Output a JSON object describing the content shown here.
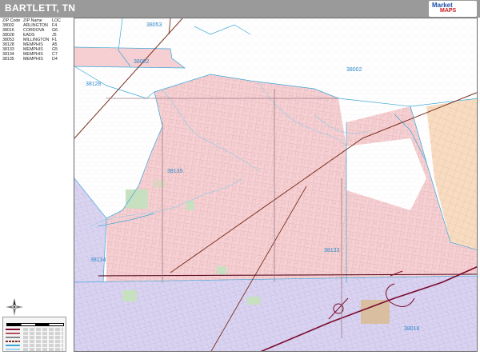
{
  "header": {
    "title": "BARTLETT, TN"
  },
  "legend": {
    "headers": {
      "zip": "ZIP Code",
      "name": "ZIP Name",
      "loc": "LOC"
    },
    "rows": [
      {
        "zip": "38002",
        "name": "ARLINGTON",
        "loc": "F4"
      },
      {
        "zip": "38016",
        "name": "CORDOVA",
        "loc": "G6"
      },
      {
        "zip": "38028",
        "name": "EADS",
        "loc": "J5"
      },
      {
        "zip": "38053",
        "name": "MILLINGTON",
        "loc": "F1"
      },
      {
        "zip": "38128",
        "name": "MEMPHIS",
        "loc": "A5"
      },
      {
        "zip": "38133",
        "name": "MEMPHIS",
        "loc": "G5"
      },
      {
        "zip": "38134",
        "name": "MEMPHIS",
        "loc": "C7"
      },
      {
        "zip": "38135",
        "name": "MEMPHIS",
        "loc": "D4"
      }
    ]
  },
  "map_labels": {
    "z38053": "38053",
    "z38002_west": "38002",
    "z38002_east": "38002",
    "z38128": "38128",
    "z38135": "38135",
    "z38134": "38134",
    "z38133": "38133",
    "z38016": "38016"
  },
  "colors": {
    "zone_38135": "#f6cfd2",
    "zone_38134": "#d9d2f0",
    "zone_38002": "#f8dcc1",
    "zone_38016": "#dfd5f2",
    "zone_38128": "#dad4f1",
    "zip_boundary": "#3aa7d9",
    "rail": "#7a2f1e",
    "highway": "#7a0a2e",
    "label": "#2d89c9"
  },
  "icons": {
    "compass": "north-arrow-icon",
    "logo": "publisher-logo"
  }
}
